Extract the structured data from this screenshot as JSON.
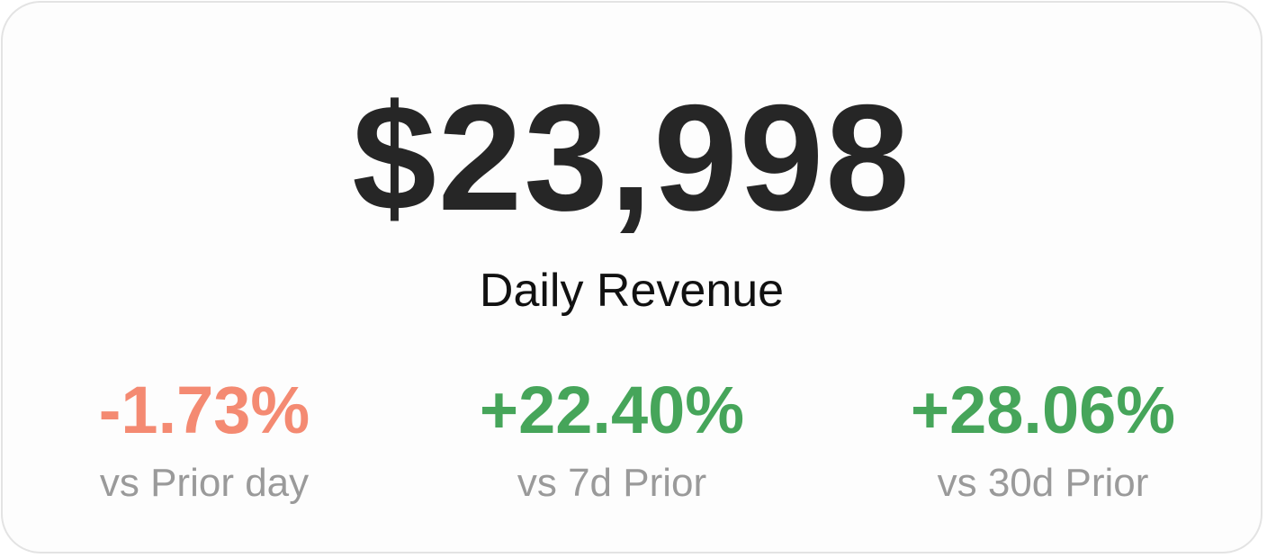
{
  "card": {
    "value": "$23,998",
    "label": "Daily Revenue"
  },
  "metrics": [
    {
      "change": "-1.73%",
      "comparison": "vs Prior day",
      "trend": "negative",
      "color": "#f48a72"
    },
    {
      "change": "+22.40%",
      "comparison": "vs 7d Prior",
      "trend": "positive",
      "color": "#46a55a"
    },
    {
      "change": "+28.06%",
      "comparison": "vs 30d Prior",
      "trend": "positive",
      "color": "#46a55a"
    }
  ],
  "colors": {
    "value_text": "#262626",
    "comparison_text": "#9a9a9a",
    "border": "#e3e3e3"
  }
}
